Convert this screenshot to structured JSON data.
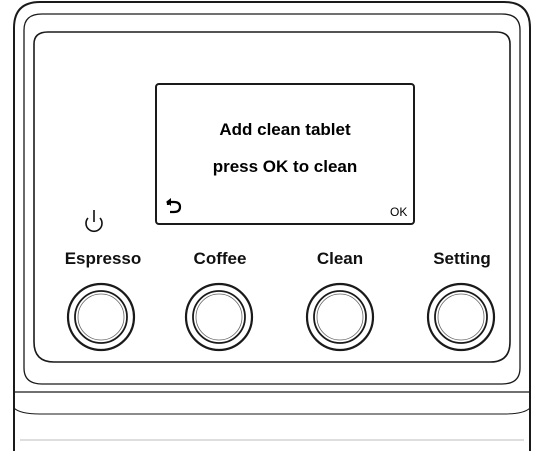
{
  "display": {
    "line1": "Add clean tablet",
    "line2": "press OK to clean",
    "back_icon": "back-arrow-icon",
    "ok_label": "OK"
  },
  "power_icon": "power-icon",
  "buttons": [
    {
      "label": "Espresso"
    },
    {
      "label": "Coffee"
    },
    {
      "label": "Clean"
    },
    {
      "label": "Setting"
    }
  ],
  "colors": {
    "outline": "#1a1a1a",
    "background": "#ffffff",
    "frame_gray": "#bdbdbd"
  }
}
